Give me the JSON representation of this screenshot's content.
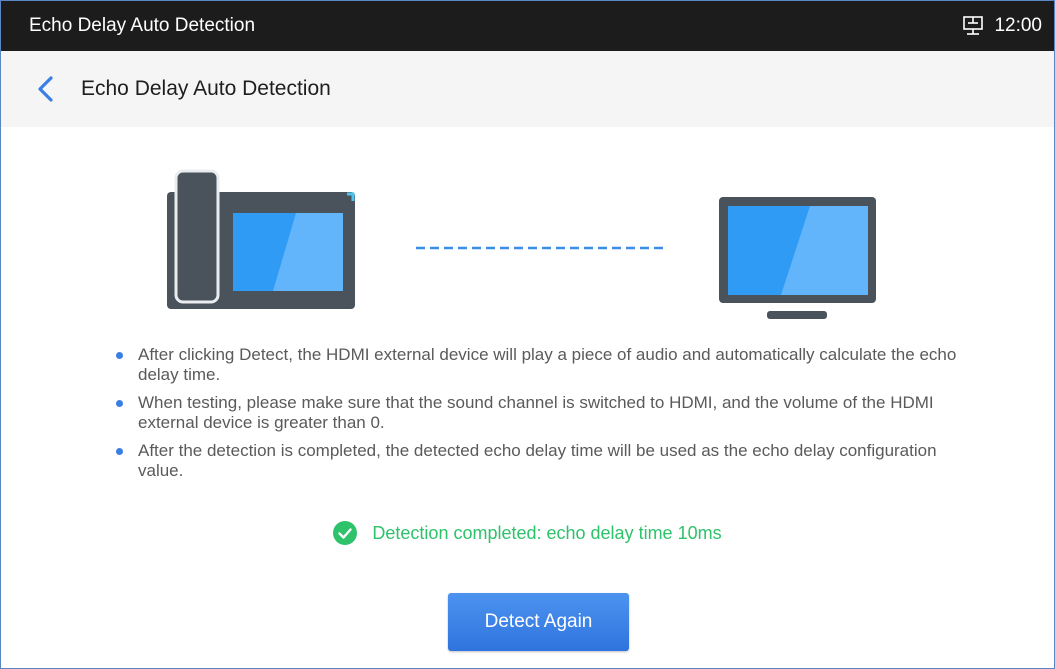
{
  "status_bar": {
    "title": "Echo Delay Auto Detection",
    "icon": "network-icon",
    "time": "12:00"
  },
  "header": {
    "back_icon": "chevron-left-icon",
    "title": "Echo Delay Auto Detection"
  },
  "illustration": {
    "left_device": "desk-phone-icon",
    "connector": "dashed-line",
    "right_device": "monitor-icon"
  },
  "instructions": [
    "After clicking Detect, the HDMI external device will play a piece of audio and automatically calculate the echo delay time.",
    "When testing, please make sure that the sound channel is switched to HDMI, and the volume of the HDMI external device is greater than 0.",
    "After the detection is completed, the detected echo delay time will be used as the echo delay configuration value."
  ],
  "result": {
    "icon": "check-circle-icon",
    "text": "Detection completed: echo delay time 10ms"
  },
  "button": {
    "label": "Detect Again"
  },
  "colors": {
    "accent": "#3a7fe6",
    "success": "#2ec26b",
    "device_body": "#4a525c",
    "screen": "#2f9bf5"
  }
}
